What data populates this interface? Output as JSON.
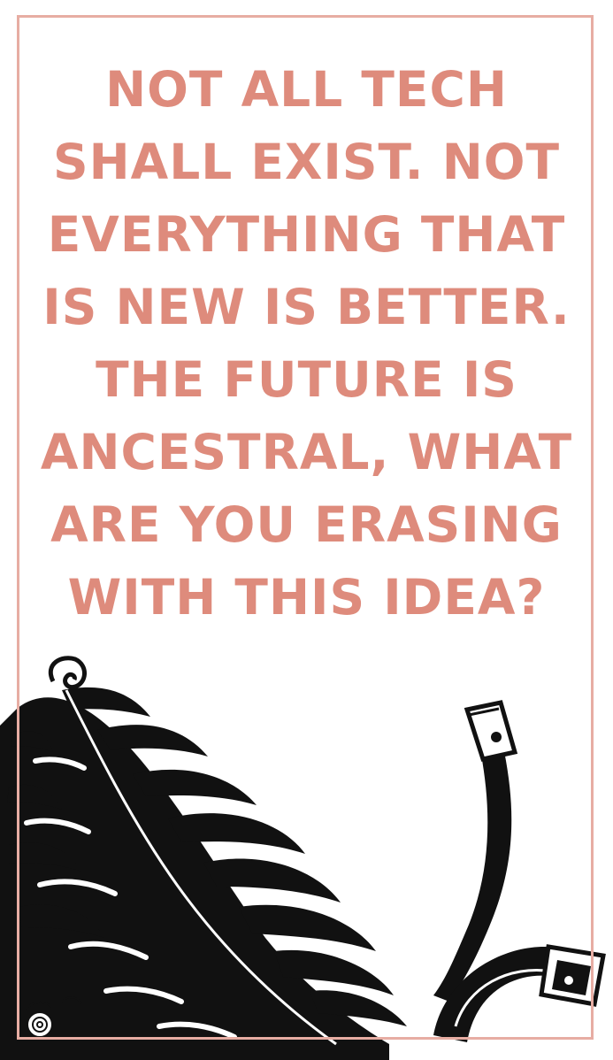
{
  "quote": {
    "lines": [
      "NOT ALL TECH",
      "SHALL EXIST. NOT",
      "EVERYTHING THAT",
      "IS NEW IS BETTER.",
      "THE FUTURE IS",
      "ANCESTRAL, WHAT",
      "ARE YOU ERASING",
      "WITH THIS IDEA?"
    ]
  },
  "colors": {
    "text": "#de8b7c",
    "frame": "#e7ada3",
    "ink": "#111111",
    "background": "#ffffff"
  },
  "illustration": {
    "elements": [
      "fern-frond-icon",
      "small-fern-curl-icon",
      "curved-tool-icon",
      "horseshoe-icon"
    ]
  }
}
